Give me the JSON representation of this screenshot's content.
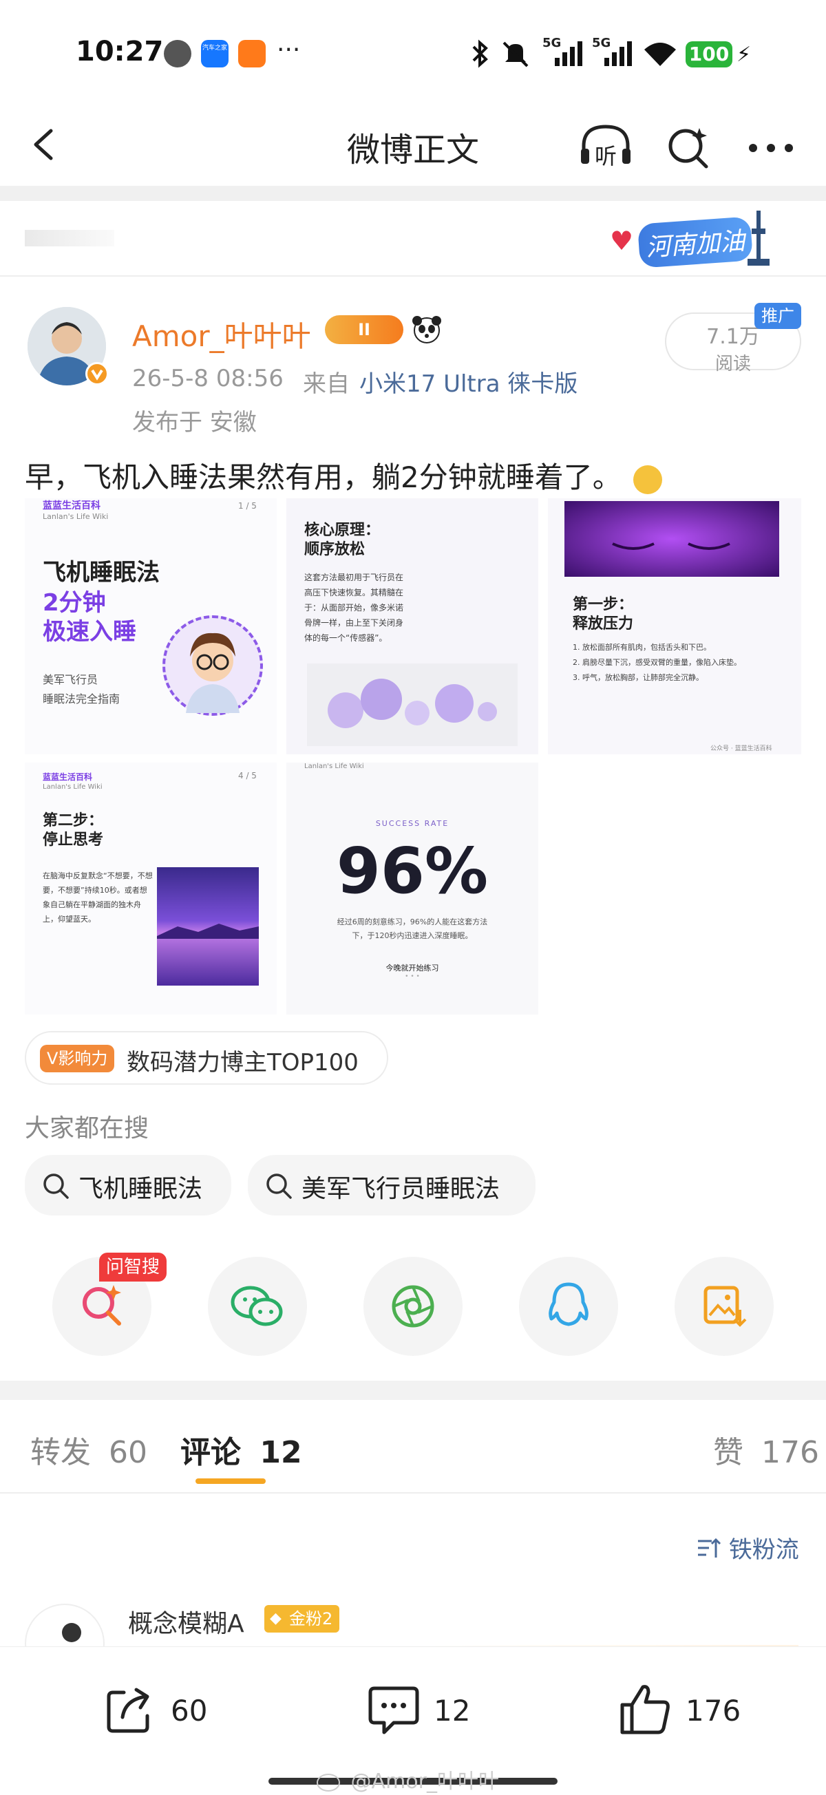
{
  "status_bar": {
    "time": "10:27",
    "network_a": "5G",
    "network_b": "5G",
    "battery": "100",
    "more": "···",
    "app_icon_labels": [
      "汽车之家"
    ]
  },
  "nav": {
    "title": "微博正文",
    "listen_icon_text": "听"
  },
  "banner": {
    "text": "河南加油"
  },
  "post": {
    "username": "Amor_叶叶叶",
    "badge_level": "II",
    "timestamp": "26-5-8 08:56",
    "source_prefix": "来自",
    "source": "小米17 Ultra 徕卡版",
    "location": "发布于 安徽",
    "reads_value": "7.1万",
    "reads_label": "阅读",
    "promo_tag": "推广",
    "text": "早，飞机入睡法果然有用，躺2分钟就睡着了。",
    "images": {
      "img1": {
        "header": "蓝蓝生活百科",
        "subheader": "Lanlan's Life Wiki",
        "page": "1 / 5",
        "title1": "飞机睡眠法",
        "title2": "2分钟",
        "title3": "极速入睡",
        "caption1": "美军飞行员",
        "caption2": "睡眠法完全指南"
      },
      "img2": {
        "title1": "核心原理：",
        "title2": "顺序放松",
        "body": "这套方法最初用于飞行员在高压下快速恢复。其精髓在于：从面部开始，像多米诺骨牌一样，由上至下关闭身体的每一个“传感器”。"
      },
      "img3": {
        "title1": "第一步：",
        "title2": "释放压力",
        "item1": "1. 放松面部所有肌肉，包括舌头和下巴。",
        "item2": "2. 肩膀尽量下沉，感受双臂的重量，像陷入床垫。",
        "item3": "3. 呼气，放松胸部，让肺部完全沉静。",
        "footer": "公众号 · 蓝蓝生活百科"
      },
      "img4": {
        "header": "蓝蓝生活百科",
        "subheader": "Lanlan's Life Wiki",
        "page": "4 / 5",
        "title1": "第二步：",
        "title2": "停止思考",
        "body": "在脑海中反复默念“不想要，不想要，不想要”持续10秒。或者想象自己躺在平静湖面的独木舟上，仰望蓝天。"
      },
      "img5": {
        "header": "Lanlan's Life Wiki",
        "label": "SUCCESS RATE",
        "big": "96%",
        "body": "经过6周的刻意练习，96%的人能在这套方法下，于120秒内迅速进入深度睡眠。",
        "footer": "今晚就开始练习",
        "dots": "• • •"
      }
    },
    "influence_badge": "V影响力",
    "influence_text": "数码潜力博主TOP100"
  },
  "searching": {
    "title": "大家都在搜",
    "chips": [
      "飞机睡眠法",
      "美军飞行员睡眠法"
    ]
  },
  "share": {
    "ask_badge": "问智搜"
  },
  "tabs": {
    "repost_label": "转发",
    "repost_count": "60",
    "comment_label": "评论",
    "comment_count": "12",
    "like_label": "赞",
    "like_count": "176"
  },
  "sort": {
    "label": "铁粉流"
  },
  "comment": {
    "username": "概念模糊A",
    "fan_badge": "金粉2"
  },
  "bottom": {
    "repost": "60",
    "comment": "12",
    "like": "176",
    "watermark": "@Amor_叶叶叶"
  },
  "colors": {
    "accent_orange": "#ec7a2a",
    "link_blue": "#4a6a99",
    "purple": "#7b3fe4"
  }
}
